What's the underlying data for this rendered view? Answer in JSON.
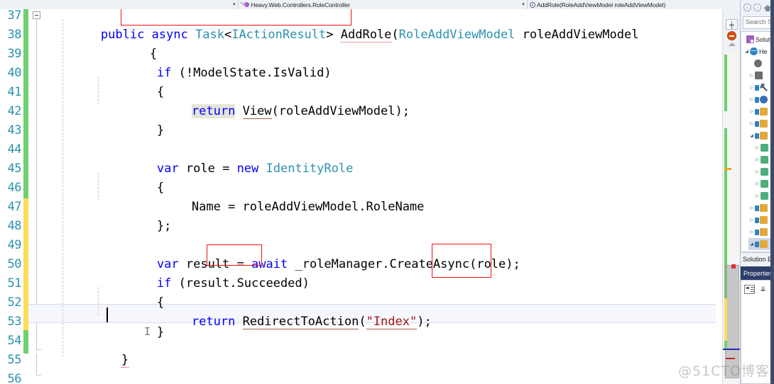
{
  "navbar": {
    "class_combo": {
      "icon": "class-member-icon",
      "modified_marker": "*",
      "value": "Heavy.Web.Controllers.RoleController",
      "dropdown_icon": "chevron-down-icon"
    },
    "member_combo": {
      "icon": "method-icon",
      "value": "AddRole(RoleAddViewModel roleAddViewModel)",
      "dropdown_icon": "chevron-down-icon"
    }
  },
  "editor": {
    "first_line_number": 37,
    "lines": [
      {
        "num": "37",
        "change": "green",
        "text": "    public async Task<IActionResult> AddRole(RoleAddViewModel roleAddViewModel"
      },
      {
        "num": "38",
        "change": "green",
        "text": "    {"
      },
      {
        "num": "39",
        "change": "green",
        "text": "        if (!ModelState.IsValid)"
      },
      {
        "num": "40",
        "change": "green",
        "text": "        {"
      },
      {
        "num": "41",
        "change": "green",
        "text": "            return View(roleAddViewModel);"
      },
      {
        "num": "42",
        "change": "green",
        "text": "        }"
      },
      {
        "num": "43",
        "change": "green",
        "text": ""
      },
      {
        "num": "44",
        "change": "green",
        "text": "        var role = new IdentityRole"
      },
      {
        "num": "45",
        "change": "green",
        "text": "        {"
      },
      {
        "num": "46",
        "change": "green",
        "text": "            Name = roleAddViewModel.RoleName"
      },
      {
        "num": "47",
        "change": "yellow",
        "text": "        };"
      },
      {
        "num": "48",
        "change": "yellow",
        "text": ""
      },
      {
        "num": "49",
        "change": "yellow",
        "text": "        var result = await _roleManager.CreateAsync(role);"
      },
      {
        "num": "50",
        "change": "yellow",
        "text": "        if (result.Succeeded)"
      },
      {
        "num": "51",
        "change": "yellow",
        "text": "        {"
      },
      {
        "num": "52",
        "change": "yellow",
        "text": "            return RedirectToAction(\"Index\");"
      },
      {
        "num": "53",
        "change": "yellow",
        "text": "        }"
      },
      {
        "num": "54",
        "change": "green",
        "text": "    }"
      },
      {
        "num": "55",
        "change": "none",
        "text": ""
      },
      {
        "num": "56",
        "change": "none",
        "text": ""
      }
    ],
    "tokens": {
      "kw_public": "public",
      "kw_async": "async",
      "type_task": "Task",
      "type_iactionresult": "IActionResult",
      "name_addrole": "AddRole",
      "type_roleaddviewmodel": "RoleAddViewModel",
      "param_roleaddviewmodel": "roleAddViewModel",
      "kw_if": "if",
      "expr_modelstate": "(!ModelState.IsValid)",
      "kw_return": "return",
      "call_view": "View",
      "arg_view": "(roleAddViewModel);",
      "kw_var": "var",
      "name_role": "role",
      "kw_new": "new",
      "type_identityrole": "IdentityRole",
      "prop_name_assign": "Name = roleAddViewModel.RoleName",
      "name_result": "result",
      "kw_await": "await",
      "call_createasync": "_roleManager.CreateAsync(role);",
      "expr_succeeded": "(result.Succeeded)",
      "call_redirect": "RedirectToAction",
      "str_index": "\"Index\"",
      "brace_open": "{",
      "brace_close": "}",
      "close_semi": "};",
      "equals": "=",
      "paren_open": "(",
      "paren_close_semi": ");",
      "underscore_semi": ";"
    },
    "annotations": [
      {
        "name": "red-box-async-task",
        "target": "async Task<IActionResult>"
      },
      {
        "name": "red-box-await",
        "target": "await"
      },
      {
        "name": "red-box-createasync",
        "target": "Async("
      }
    ],
    "current_line": "53",
    "caret_after": "}"
  },
  "scrollbar": {
    "splitter_icon": "split-view-icon",
    "stop_icon": "stop-error-icon",
    "up_arrow_icon": "scroll-up-arrow-icon"
  },
  "right_dock": {
    "nav_back_icon": "back-arrow-icon",
    "nav_forward_icon": "forward-arrow-icon",
    "nav_home_icon": "home-icon",
    "search": {
      "placeholder": "Search Sol",
      "value": ""
    },
    "tree": [
      {
        "label": "Solut",
        "icon": "solution-icon",
        "indent": 0,
        "twisty": "",
        "selected": false
      },
      {
        "label": "He",
        "icon": "project-icon",
        "indent": 1,
        "twisty": "down",
        "selected": false
      },
      {
        "label": "",
        "icon": "connected-services-icon",
        "indent": 2,
        "twisty": "",
        "selected": false
      },
      {
        "label": "",
        "icon": "dependencies-icon",
        "indent": 2,
        "twisty": "right",
        "selected": false
      },
      {
        "label": "",
        "icon": "wrench-icon",
        "indent": 2,
        "twisty": "right",
        "selected": false
      },
      {
        "label": "",
        "icon": "globe-icon",
        "indent": 2,
        "twisty": "right",
        "selected": false
      },
      {
        "label": "",
        "icon": "folder-icon",
        "indent": 2,
        "twisty": "right",
        "selected": false
      },
      {
        "label": "",
        "icon": "folder-icon",
        "indent": 2,
        "twisty": "right",
        "selected": false
      },
      {
        "label": "",
        "icon": "folder-open-icon",
        "indent": 2,
        "twisty": "down",
        "selected": false
      },
      {
        "label": "",
        "icon": "cs-file-icon",
        "indent": 3,
        "twisty": "right",
        "selected": false
      },
      {
        "label": "",
        "icon": "cs-file-icon",
        "indent": 3,
        "twisty": "right",
        "selected": false
      },
      {
        "label": "",
        "icon": "cs-file-icon",
        "indent": 3,
        "twisty": "right",
        "selected": false
      },
      {
        "label": "",
        "icon": "cs-file-icon",
        "indent": 3,
        "twisty": "right",
        "selected": false
      },
      {
        "label": "",
        "icon": "cs-file-icon",
        "indent": 3,
        "twisty": "right",
        "selected": false
      },
      {
        "label": "",
        "icon": "folder-icon",
        "indent": 2,
        "twisty": "right",
        "selected": false
      },
      {
        "label": "",
        "icon": "folder-icon",
        "indent": 2,
        "twisty": "right",
        "selected": false
      },
      {
        "label": "",
        "icon": "folder-icon",
        "indent": 2,
        "twisty": "right",
        "selected": false
      },
      {
        "label": "",
        "icon": "folder-open-icon",
        "indent": 2,
        "twisty": "down",
        "selected": true
      },
      {
        "label": "",
        "icon": "cs-file-icon",
        "indent": 3,
        "twisty": "right",
        "selected": false
      },
      {
        "label": "",
        "icon": "cs-file-icon",
        "indent": 3,
        "twisty": "right",
        "selected": false
      },
      {
        "label": "",
        "icon": "cs-file-icon",
        "indent": 3,
        "twisty": "right",
        "selected": false
      },
      {
        "label": "",
        "icon": "cs-file-icon",
        "indent": 3,
        "twisty": "right",
        "selected": false
      },
      {
        "label": "",
        "icon": "cs-file-icon",
        "indent": 3,
        "twisty": "right",
        "selected": false
      },
      {
        "label": "",
        "icon": "cs-file-icon",
        "indent": 3,
        "twisty": "right",
        "selected": false
      },
      {
        "label": "",
        "icon": "folder-icon",
        "indent": 2,
        "twisty": "down",
        "selected": false
      }
    ],
    "solution_explorer_tab": "Solution Ex",
    "properties_title": "Properties",
    "properties_toolbar": {
      "categorized_icon": "categorized-view-icon",
      "alphabetical_icon": "alphabetical-sort-icon"
    }
  },
  "watermark": "@51CTO博客"
}
